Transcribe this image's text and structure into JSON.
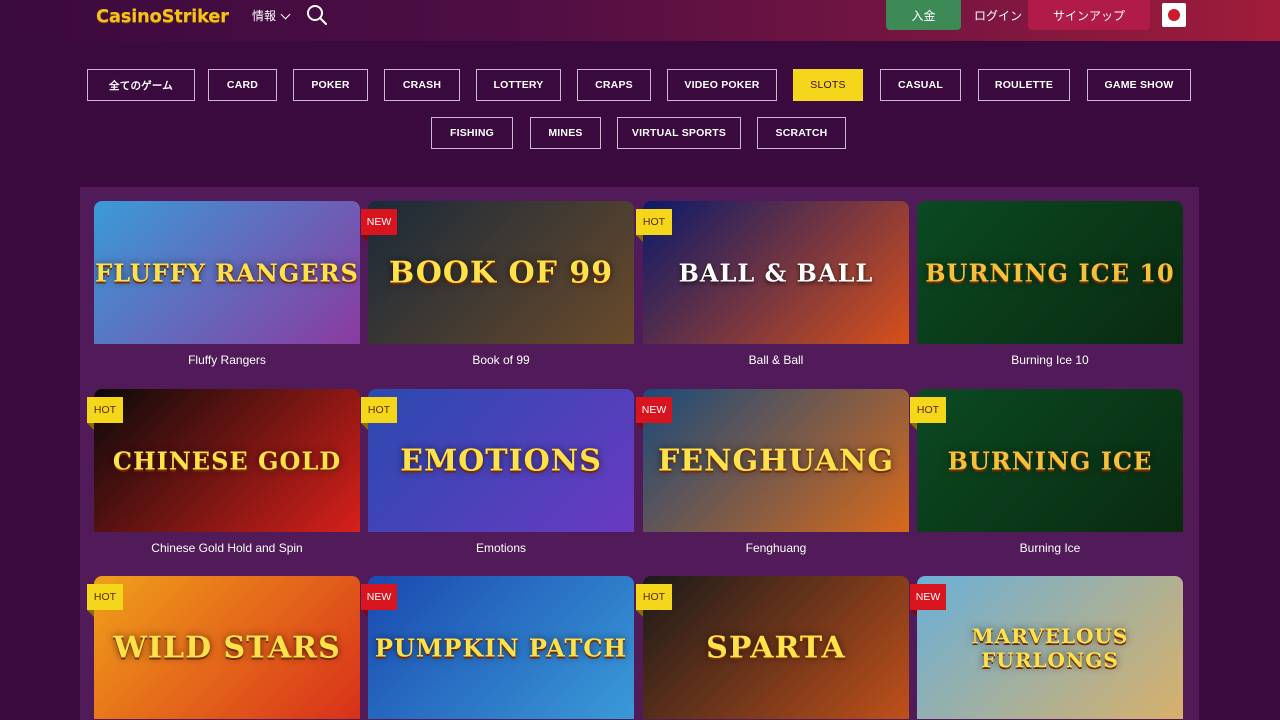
{
  "header": {
    "logo": "CasinoStriker",
    "info_label": "情報",
    "deposit_label": "入金",
    "login_label": "ログイン",
    "signup_label": "サインアップ",
    "language": "Japanese"
  },
  "categories": {
    "row1": [
      "全てのゲーム",
      "CARD",
      "POKER",
      "CRASH",
      "LOTTERY",
      "CRAPS",
      "VIDEO POKER",
      "SLOTS",
      "CASUAL",
      "ROULETTE",
      "GAME SHOW"
    ],
    "row2": [
      "FISHING",
      "MINES",
      "VIRTUAL SPORTS",
      "SCRATCH"
    ],
    "active": "SLOTS"
  },
  "games": [
    {
      "name": "Fluffy Rangers",
      "art_title": "FLUFFY RANGERS",
      "tag": "",
      "colors": [
        "#3a9bd8",
        "#8b3aa0"
      ]
    },
    {
      "name": "Book of 99",
      "art_title": "BOOK OF 99",
      "tag": "NEW",
      "colors": [
        "#1a2a3a",
        "#6a4a2a"
      ]
    },
    {
      "name": "Ball & Ball",
      "art_title": "BALL & BALL",
      "tag": "HOT",
      "colors": [
        "#0a1a6a",
        "#d8501a"
      ]
    },
    {
      "name": "Burning Ice 10",
      "art_title": "BURNING ICE 10",
      "tag": "",
      "colors": [
        "#0a4a22",
        "#0a2a10"
      ]
    },
    {
      "name": "Chinese Gold Hold and Spin",
      "art_title": "CHINESE GOLD",
      "tag": "HOT",
      "colors": [
        "#0a0a0a",
        "#d8201a"
      ]
    },
    {
      "name": "Emotions",
      "art_title": "EMOTIONS",
      "tag": "HOT",
      "colors": [
        "#2a4ab0",
        "#6a3ac0"
      ]
    },
    {
      "name": "Fenghuang",
      "art_title": "FENGHUANG",
      "tag": "NEW",
      "colors": [
        "#1a4a7a",
        "#d86a1a"
      ]
    },
    {
      "name": "Burning Ice",
      "art_title": "BURNING ICE",
      "tag": "HOT",
      "colors": [
        "#0a4a22",
        "#0a2a10"
      ]
    },
    {
      "name": "",
      "art_title": "WILD STARS",
      "tag": "HOT",
      "colors": [
        "#f0a01a",
        "#d8301a"
      ]
    },
    {
      "name": "",
      "art_title": "PUMPKIN PATCH",
      "tag": "NEW",
      "colors": [
        "#1a4ab0",
        "#3a9ad8"
      ]
    },
    {
      "name": "",
      "art_title": "SPARTA",
      "tag": "HOT",
      "colors": [
        "#1a1a1a",
        "#c0501a"
      ]
    },
    {
      "name": "",
      "art_title": "MARVELOUS FURLONGS",
      "tag": "NEW",
      "colors": [
        "#6ab0d8",
        "#d8b06a"
      ]
    }
  ]
}
